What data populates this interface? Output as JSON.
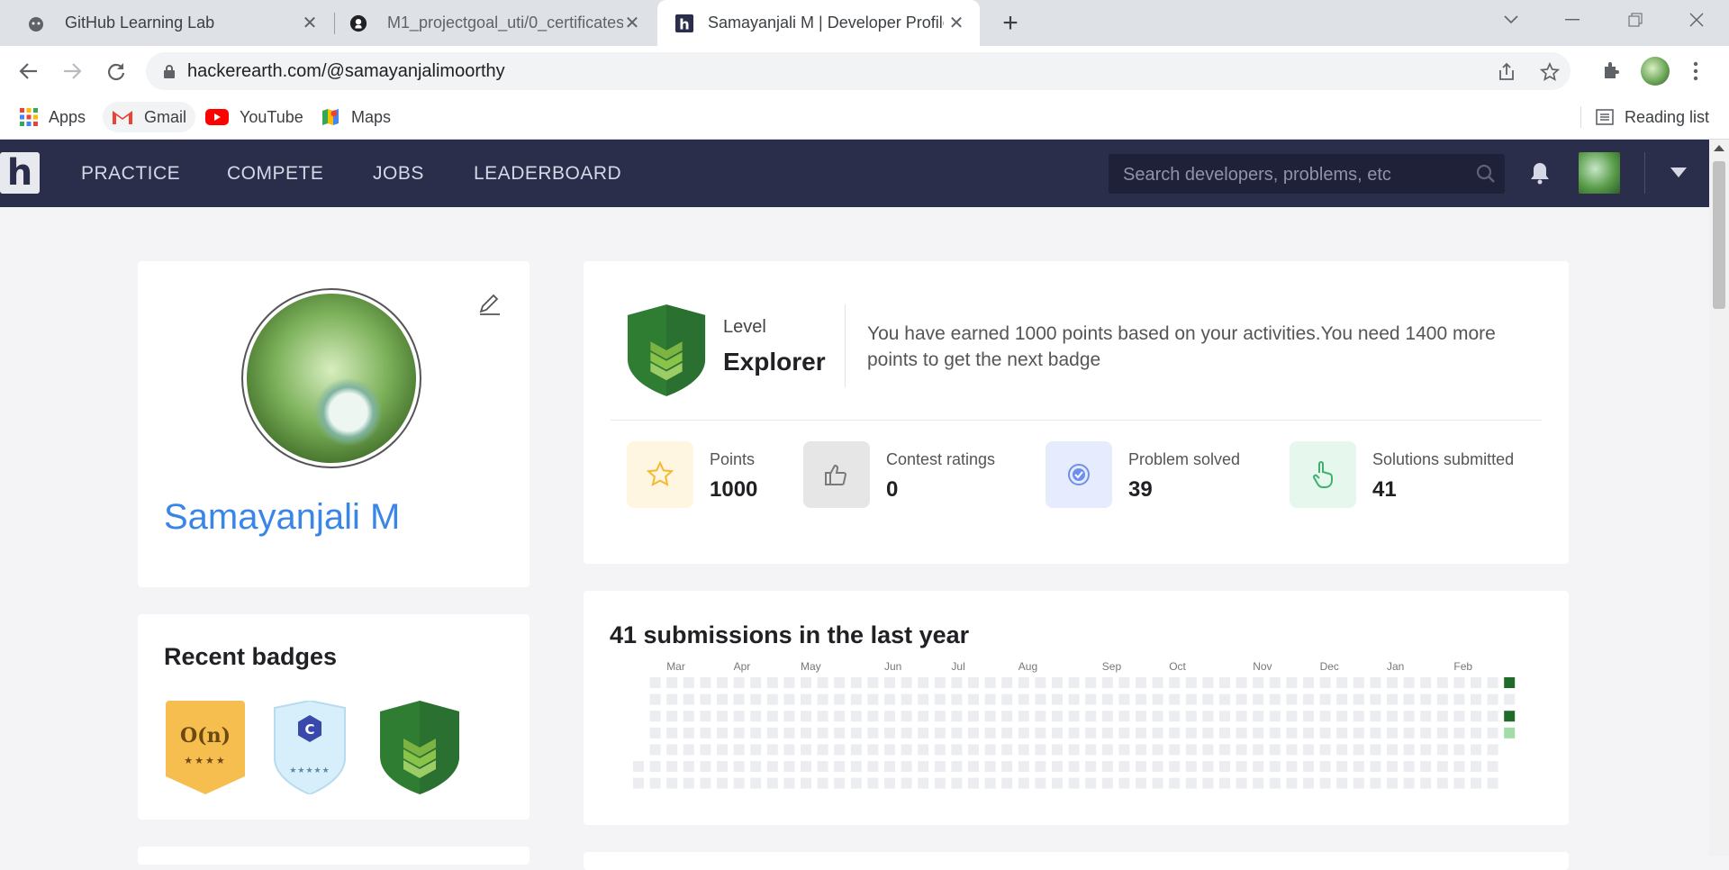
{
  "browser": {
    "tabs": [
      {
        "title": "GitHub Learning Lab",
        "active": false
      },
      {
        "title": "M1_projectgoal_uti/0_certificates",
        "active": false
      },
      {
        "title": "Samayanjali M | Developer Profile",
        "active": true
      }
    ],
    "url": "hackerearth.com/@samayanjalimoorthy",
    "bookmarks": [
      "Apps",
      "Gmail",
      "YouTube",
      "Maps"
    ],
    "reading_list": "Reading list"
  },
  "site": {
    "logo": "h",
    "nav": [
      "PRACTICE",
      "COMPETE",
      "JOBS",
      "LEADERBOARD"
    ],
    "search_placeholder": "Search developers, problems, etc"
  },
  "profile": {
    "name": "Samayanjali M",
    "recent_badges_title": "Recent badges",
    "badges": [
      {
        "name": "O(n)",
        "stars": "★★★★",
        "color": "#f6be4f"
      },
      {
        "name": "C",
        "stars": "★★★★★",
        "color": "#d6effa"
      },
      {
        "name": "Explorer",
        "color": "#2e7d32"
      }
    ]
  },
  "level": {
    "label": "Level",
    "name": "Explorer",
    "description": "You have earned 1000 points based on your activities.You need 1400 more points to get the next badge"
  },
  "stats": [
    {
      "label": "Points",
      "value": "1000",
      "icon": "star-icon",
      "bg": "#fef6e0",
      "color": "#f5b931"
    },
    {
      "label": "Contest ratings",
      "value": "0",
      "icon": "thumbs-up-icon",
      "bg": "#e6e6e6",
      "color": "#7a7a7a"
    },
    {
      "label": "Problem solved",
      "value": "39",
      "icon": "check-badge-icon",
      "bg": "#e6ebfd",
      "color": "#6d8ff0"
    },
    {
      "label": "Solutions submitted",
      "value": "41",
      "icon": "pointer-hand-icon",
      "bg": "#e6f7ee",
      "color": "#3fb16f"
    }
  ],
  "submissions": {
    "title": "41 submissions in the last year",
    "months": [
      "Mar",
      "Apr",
      "May",
      "Jun",
      "Jul",
      "Aug",
      "Sep",
      "Oct",
      "Nov",
      "Dec",
      "Jan",
      "Feb"
    ],
    "active_cells": [
      {
        "week": 52,
        "day": 0,
        "level": 3
      },
      {
        "week": 52,
        "day": 2,
        "level": 3
      },
      {
        "week": 52,
        "day": 3,
        "level": 1
      }
    ],
    "colors": {
      "empty": "#ebedf0",
      "level1": "#a3dca6",
      "level3": "#1e6b2a"
    }
  }
}
